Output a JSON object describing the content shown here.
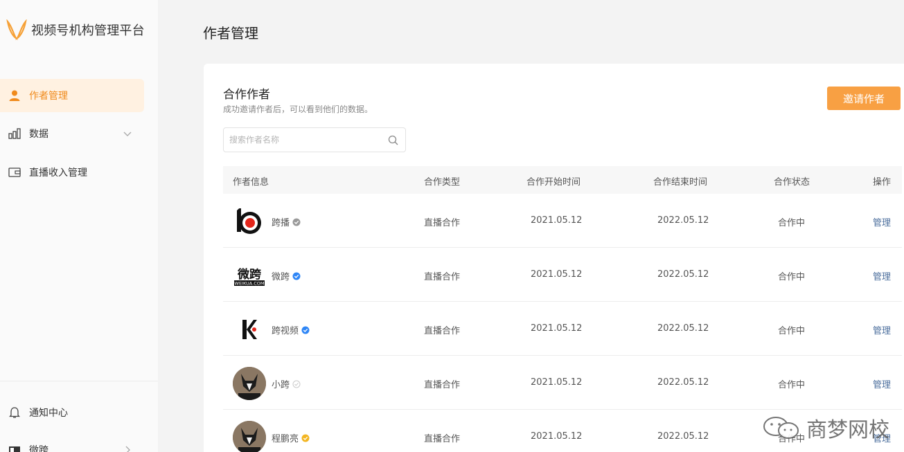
{
  "app": {
    "title": "视频号机构管理平台"
  },
  "sidebar": {
    "items": [
      {
        "label": "作者管理",
        "icon": "user-icon",
        "active": true
      },
      {
        "label": "数据",
        "icon": "bar-chart-icon",
        "active": false
      },
      {
        "label": "直播收入管理",
        "icon": "wallet-icon",
        "active": false
      }
    ],
    "bottom_items": [
      {
        "label": "通知中心",
        "icon": "bell-icon"
      },
      {
        "label": "微跨",
        "icon": "account-icon"
      }
    ]
  },
  "page": {
    "title": "作者管理"
  },
  "card": {
    "title": "合作作者",
    "subtitle": "成功邀请作者后，可以看到他们的数据。",
    "invite_button": "邀请作者",
    "search_placeholder": "搜索作者名称"
  },
  "table": {
    "headers": [
      "作者信息",
      "合作类型",
      "合作开始时间",
      "合作结束时间",
      "合作状态",
      "操作"
    ],
    "rows": [
      {
        "name": "跨播",
        "verify": "gray",
        "type": "直播合作",
        "start": "2021.05.12",
        "end": "2022.05.12",
        "status": "合作中",
        "action": "管理"
      },
      {
        "name": "微跨",
        "verify": "blue",
        "type": "直播合作",
        "start": "2021.05.12",
        "end": "2022.05.12",
        "status": "合作中",
        "action": "管理"
      },
      {
        "name": "跨视频",
        "verify": "blue",
        "type": "直播合作",
        "start": "2021.05.12",
        "end": "2022.05.12",
        "status": "合作中",
        "action": "管理"
      },
      {
        "name": "小跨",
        "verify": "outline",
        "type": "直播合作",
        "start": "2021.05.12",
        "end": "2022.05.12",
        "status": "合作中",
        "action": "管理"
      },
      {
        "name": "程鹏亮",
        "verify": "yellow",
        "type": "直播合作",
        "start": "2021.05.12",
        "end": "2022.05.12",
        "status": "合作中",
        "action": "管理"
      }
    ]
  },
  "avatar_texts": {
    "weikua_logo": "微跨",
    "weikua_url": "WEIKUA.COM"
  },
  "watermark": {
    "text": "商梦网校"
  },
  "colors": {
    "accent": "#f8a043",
    "active_bg": "#fff1e1",
    "active_text": "#f08a1c",
    "link": "#4a6d9c",
    "verify_blue": "#2f86f6",
    "verify_yellow": "#f3b623"
  }
}
